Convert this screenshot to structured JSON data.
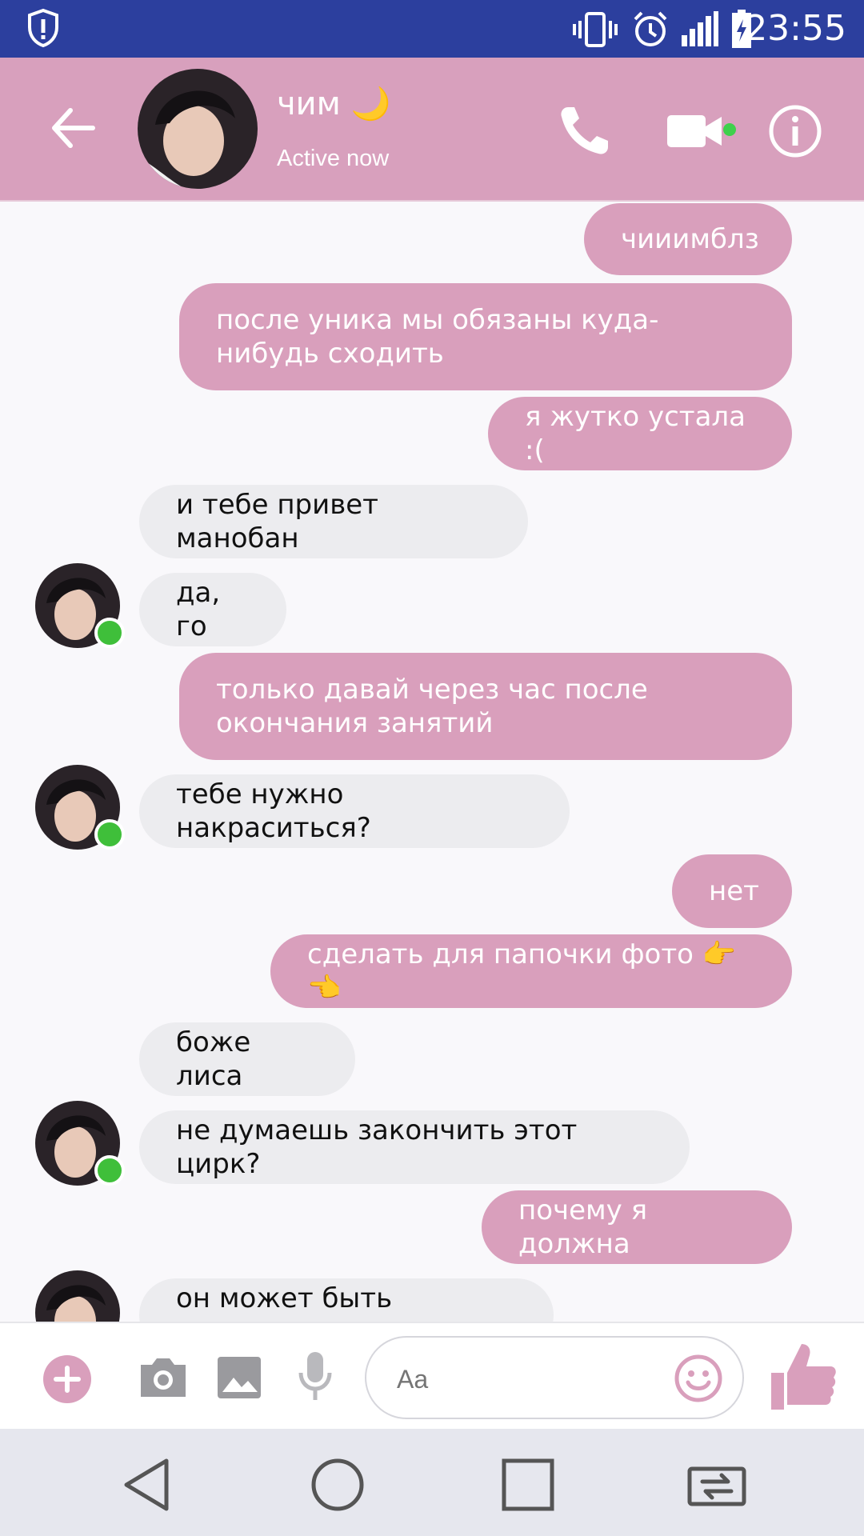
{
  "status_bar": {
    "time": "23:55"
  },
  "header": {
    "name": "чим 🌙",
    "status": "Active now"
  },
  "messages": [
    {
      "dir": "out",
      "text": "чииимблз"
    },
    {
      "dir": "out",
      "text": "после уника мы обязаны куда-нибудь сходить"
    },
    {
      "dir": "out",
      "text": "я жутко устала :("
    },
    {
      "dir": "in",
      "text": "и тебе привет манобан"
    },
    {
      "dir": "in",
      "text": "да, го"
    },
    {
      "dir": "out",
      "text": "только давай через час после окончания занятий"
    },
    {
      "dir": "in",
      "text": "тебе нужно накраситься?"
    },
    {
      "dir": "out",
      "text": "нет"
    },
    {
      "dir": "out",
      "text": "сделать для папочки фото 👉👈"
    },
    {
      "dir": "in",
      "text": "боже лиса"
    },
    {
      "dir": "in",
      "text": "не думаешь закончить этот цирк?"
    },
    {
      "dir": "out",
      "text": "почему я должна"
    },
    {
      "dir": "in",
      "text": "он может быть опасным"
    }
  ],
  "composer": {
    "placeholder": "Aa"
  },
  "colors": {
    "accent": "#d99fbc",
    "header": "#d8a0bd",
    "status_bar": "#2c3f9e",
    "online": "#3fbf3a"
  },
  "icons": [
    "shield-alert-icon",
    "vibrate-icon",
    "alarm-icon",
    "signal-icon",
    "battery-icon",
    "back-arrow-icon",
    "phone-icon",
    "video-icon",
    "info-icon",
    "plus-icon",
    "camera-icon",
    "image-icon",
    "mic-icon",
    "emoji-icon",
    "like-icon",
    "nav-back-icon",
    "nav-home-icon",
    "nav-recents-icon",
    "nav-switch-icon"
  ]
}
